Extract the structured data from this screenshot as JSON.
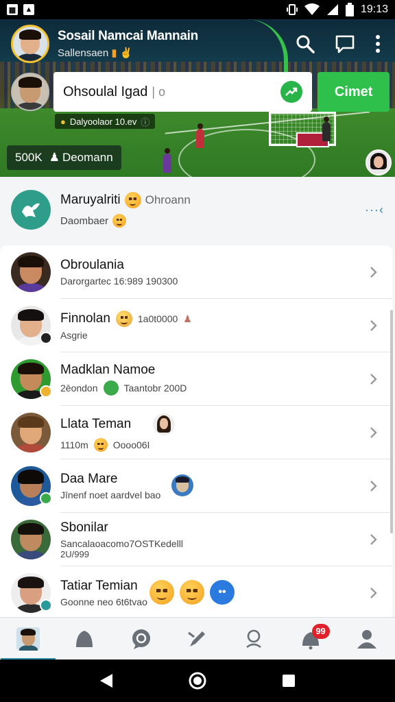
{
  "status_bar": {
    "left_icons": [
      "app-icon-a",
      "app-icon-b"
    ],
    "time": "19:13"
  },
  "header": {
    "title": "Sosail Namcai Mannain",
    "subtitle": "Sallensaen",
    "search": {
      "value": "Ohsoulal Igad",
      "caret": "| o"
    },
    "go_button": "Cimet",
    "tag_text": "Dalyoolaor 10.ev",
    "chip_count": "500K",
    "chip_label": "Deomann"
  },
  "featured": {
    "title": "Maruyalriti",
    "title_extra": "Ohroann",
    "subtitle": "Daombaer",
    "more": "···‹"
  },
  "friends": [
    {
      "name": "Obroulania",
      "sub": "Darorgartec 16:989 190300",
      "avatar_bg": "#3a2a20",
      "skin": "#c98a62",
      "hair": "#1a1008",
      "shirt": "#5a3a9a"
    },
    {
      "name": "Finnolan",
      "sub": "Asgrie",
      "extra": "1a0t0000",
      "avatar_bg": "#e8e8e8",
      "skin": "#e2b08a",
      "hair": "#151010",
      "shirt": "#f2f2f2"
    },
    {
      "name": "Madklan Namoe",
      "sub": "2ēondon",
      "extra": "Taantobr 200D",
      "avatar_bg": "#2e9a30",
      "skin": "#c58a5a",
      "hair": "#1a1008",
      "shirt": "#1a1a1a"
    },
    {
      "name": "Llata Teman",
      "sub": "1110m",
      "extra": "Oooo06I",
      "avatar_bg": "#7a5a3a",
      "skin": "#e0a878",
      "hair": "#5a3a1a",
      "shirt": "#b04a3a"
    },
    {
      "name": "Daa Mare",
      "sub": "Jīnenf noet aardvel bao",
      "avatar_bg": "#1e5a9a",
      "skin": "#b8805a",
      "hair": "#0e0a08",
      "shirt": "#2a5aa0"
    },
    {
      "name": "Sbonilar",
      "sub": "Sancalaoacomo7OSTKedelll",
      "sub2": "2U/999",
      "avatar_bg": "#3a6a3a",
      "skin": "#c08a60",
      "hair": "#14100c",
      "shirt": "#3a4a7a"
    },
    {
      "name": "Tatiar Temian",
      "sub": "Goonne neo 6t6tvao",
      "avatar_bg": "#eeeeee",
      "skin": "#d8a080",
      "hair": "#1a1210",
      "shirt": "#2a2a2a"
    }
  ],
  "bottom_nav": {
    "items": [
      "home-profile-icon",
      "bell-icon",
      "chat-bubble-icon",
      "edit-icon",
      "location-icon",
      "notifications-icon",
      "profile-icon"
    ],
    "badge": "99"
  },
  "colors": {
    "accent_green": "#2fc04c",
    "teal": "#2e9e8a",
    "badge_red": "#e0202a"
  }
}
